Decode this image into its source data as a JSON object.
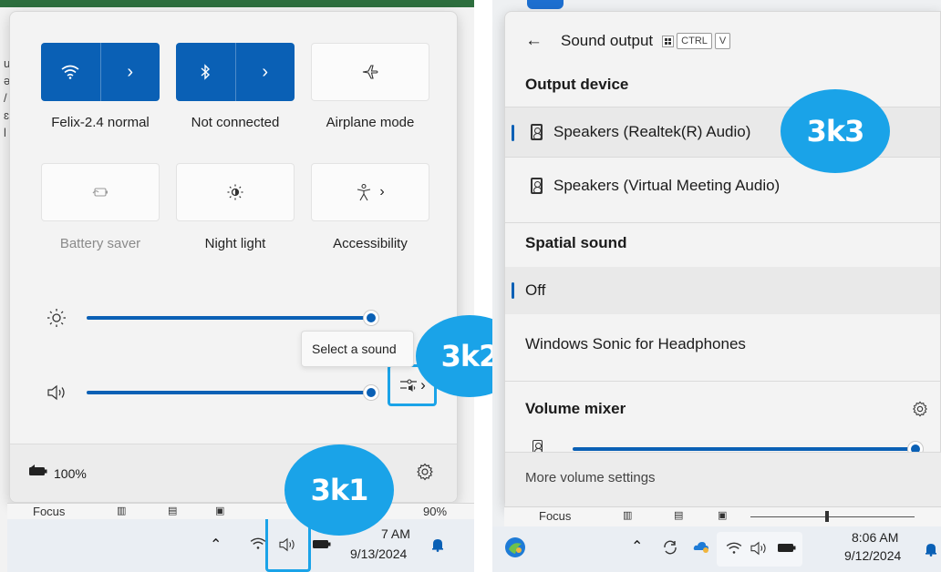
{
  "left": {
    "tiles": [
      {
        "label": "Felix-2.4 normal",
        "state": "on",
        "icon": "wifi-icon"
      },
      {
        "label": "Not connected",
        "state": "on",
        "icon": "bluetooth-icon"
      },
      {
        "label": "Airplane mode",
        "state": "off",
        "icon": "airplane-icon"
      },
      {
        "label": "Battery saver",
        "state": "disabled",
        "icon": "battery-saver-icon"
      },
      {
        "label": "Night light",
        "state": "off",
        "icon": "night-light-icon"
      },
      {
        "label": "Accessibility",
        "state": "off",
        "icon": "accessibility-icon"
      }
    ],
    "brightness_level": 1.0,
    "volume_level": 1.0,
    "tooltip": "Select a sound",
    "battery_percent": "100%",
    "callout_1": "3k1",
    "callout_2": "3k2",
    "word_focus": "Focus",
    "word_zoom": "90%",
    "time": "7 AM",
    "date": "9/13/2024"
  },
  "right": {
    "header_title": "Sound output",
    "shortcut_keys": [
      "CTRL",
      "V"
    ],
    "output_device_heading": "Output device",
    "devices": [
      {
        "name": "Speakers (Realtek(R) Audio)",
        "selected": true
      },
      {
        "name": "Speakers (Virtual Meeting Audio)",
        "selected": false
      }
    ],
    "spatial_heading": "Spatial sound",
    "spatial_options": [
      {
        "name": "Off",
        "selected": true
      },
      {
        "name": "Windows Sonic for Headphones",
        "selected": false
      }
    ],
    "volume_mixer_heading": "Volume mixer",
    "more_volume_settings": "More volume settings",
    "callout_3": "3k3",
    "word_focus": "Focus",
    "time": "8:06 AM",
    "date": "9/12/2024"
  },
  "colors": {
    "accent": "#0a60b5",
    "callout": "#1aa3e8"
  }
}
